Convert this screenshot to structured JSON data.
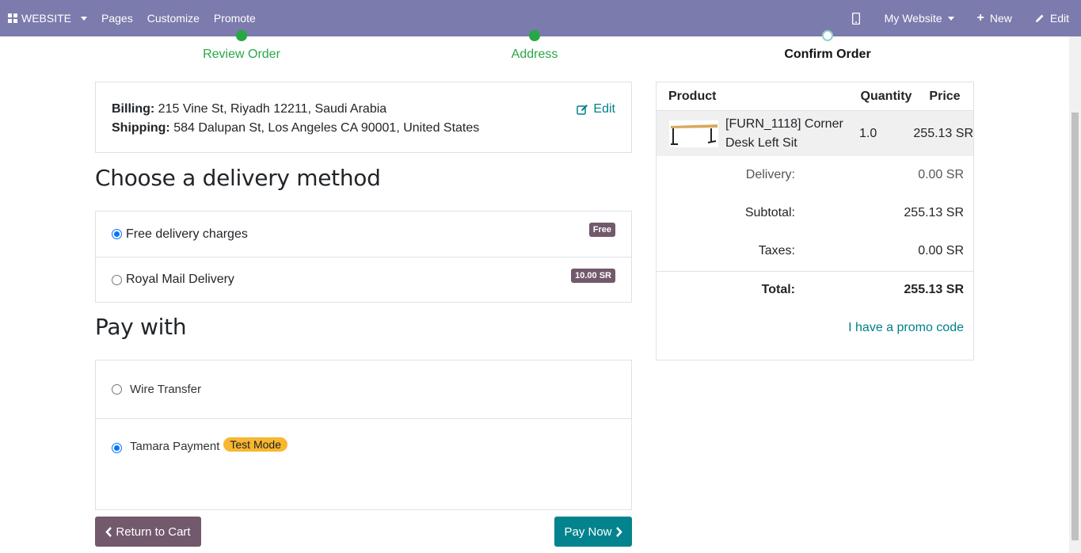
{
  "topbar": {
    "apps_label": "WEBSITE",
    "menu": [
      "Pages",
      "Customize",
      "Promote"
    ],
    "site_label": "My Website",
    "new_label": "New",
    "edit_label": "Edit"
  },
  "steps": [
    {
      "label": "Review Order",
      "state": "done"
    },
    {
      "label": "Address",
      "state": "done"
    },
    {
      "label": "Confirm Order",
      "state": "active"
    }
  ],
  "address": {
    "billing_label": "Billing:",
    "billing_value": "215 Vine St, Riyadh 12211, Saudi Arabia",
    "shipping_label": "Shipping:",
    "shipping_value": "584 Dalupan St, Los Angeles CA 90001, United States",
    "edit_label": "Edit"
  },
  "delivery": {
    "heading": "Choose a delivery method",
    "options": [
      {
        "label": "Free delivery charges",
        "badge": "Free",
        "selected": true
      },
      {
        "label": "Royal Mail Delivery",
        "badge": "10.00 SR",
        "selected": false
      }
    ]
  },
  "payment": {
    "heading": "Pay with",
    "options": [
      {
        "label": "Wire Transfer",
        "selected": false
      },
      {
        "label": "Tamara Payment",
        "badge": "Test Mode",
        "selected": true
      }
    ]
  },
  "buttons": {
    "back": "Return to Cart",
    "pay": "Pay Now"
  },
  "cart": {
    "headers": [
      "Product",
      "Quantity",
      "Price"
    ],
    "line": {
      "name": "[FURN_1118] Corner Desk Left Sit",
      "qty": "1.0",
      "price": "255.13 SR"
    },
    "delivery_label": "Delivery:",
    "delivery_value": "0.00 SR",
    "subtotal_label": "Subtotal:",
    "subtotal_value": "255.13 SR",
    "taxes_label": "Taxes:",
    "taxes_value": "0.00 SR",
    "total_label": "Total:",
    "total_value": "255.13 SR",
    "promo_label": "I have a promo code"
  },
  "colors": {
    "topbar": "#7c7bad",
    "accent": "#01808a",
    "secondary": "#72596c",
    "success": "#28a745"
  }
}
